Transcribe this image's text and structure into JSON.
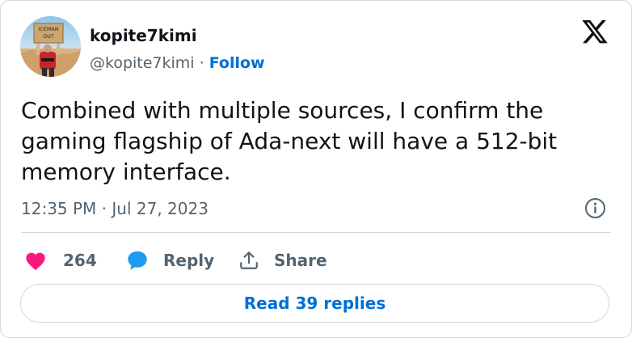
{
  "author": {
    "display_name": "kopite7kimi",
    "handle": "@kopite7kimi",
    "separator": " · ",
    "follow_label": "Follow",
    "avatar_sign_text": [
      "ICEMAN",
      "OUT"
    ]
  },
  "tweet": {
    "text": "Combined with multiple sources, I confirm the gaming flagship of Ada-next will have a 512-bit memory interface.",
    "timestamp": "12:35 PM · Jul 27, 2023"
  },
  "actions": {
    "like_count": "264",
    "reply_label": "Reply",
    "share_label": "Share"
  },
  "read_replies_label": "Read 39 replies",
  "icons": {
    "brand": "x-logo-icon",
    "info": "info-icon",
    "like": "heart-icon",
    "reply": "speech-bubble-icon",
    "share": "share-upload-icon"
  },
  "colors": {
    "like": "#f91880",
    "reply": "#1d9bf0",
    "link": "#006fd6",
    "secondary_text": "#536471",
    "border": "#cfd9de"
  }
}
